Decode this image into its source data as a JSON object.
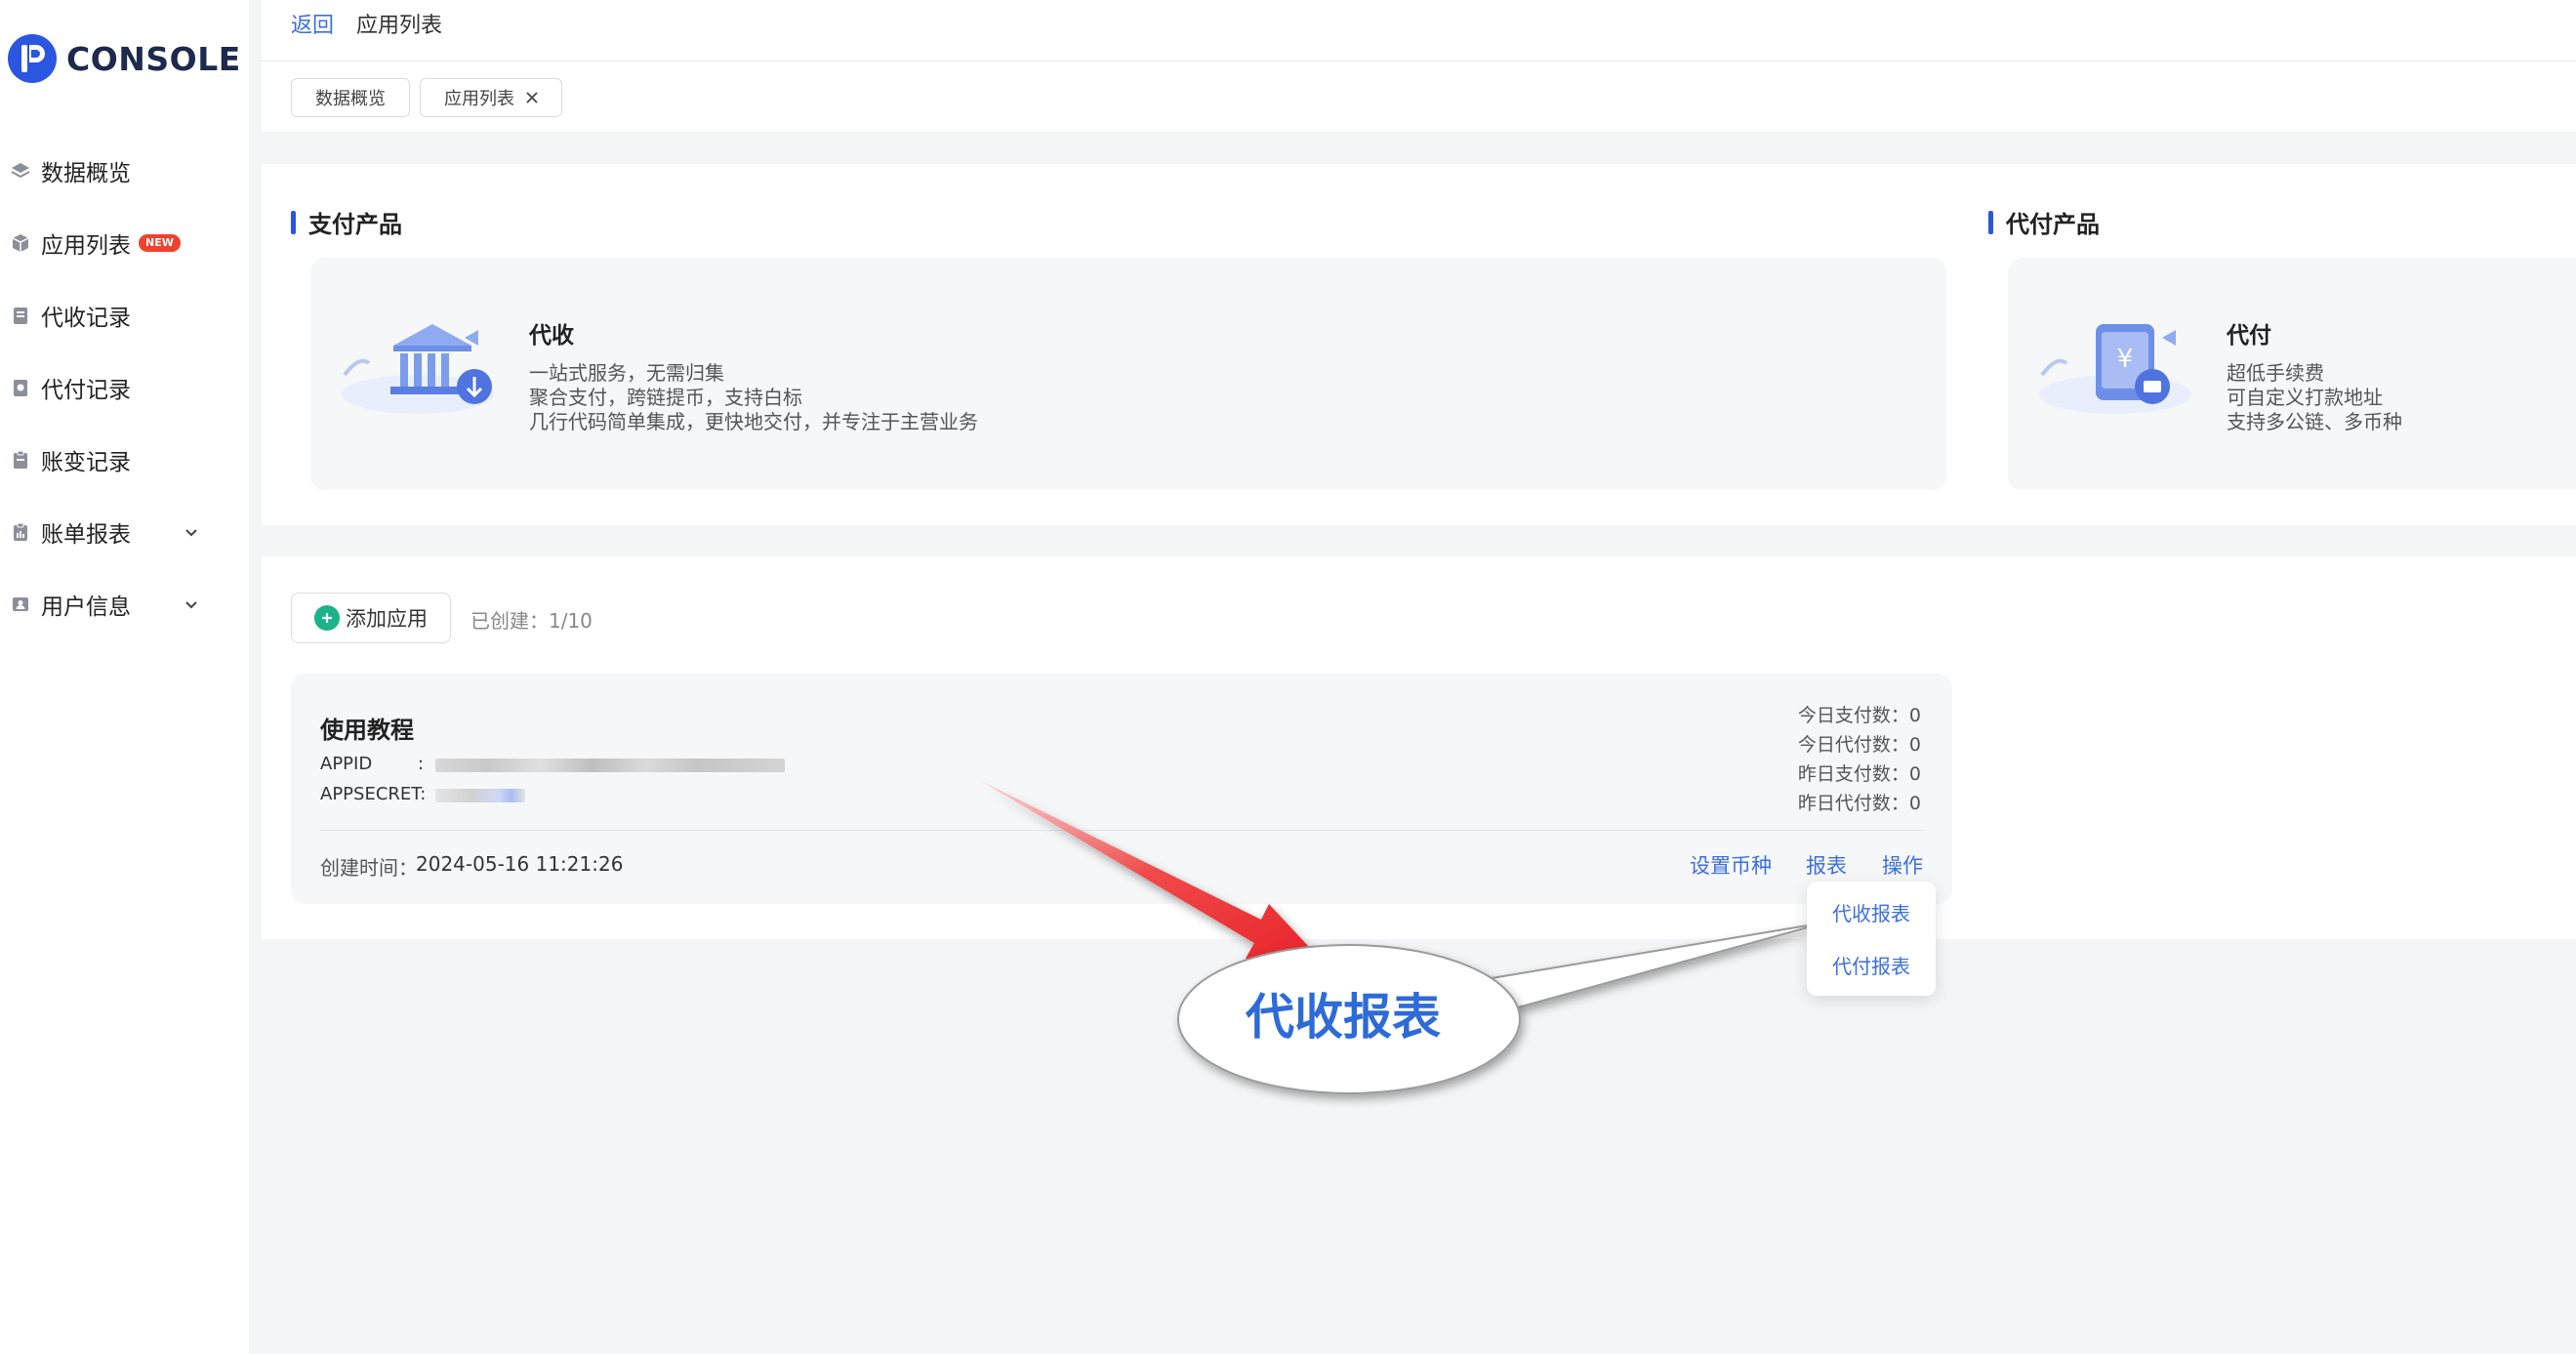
{
  "app": {
    "logo_text": "CONSOLE"
  },
  "sidebar": {
    "items": [
      {
        "label": "数据概览",
        "icon": "layers-icon"
      },
      {
        "label": "应用列表",
        "icon": "cube-icon",
        "badge": "NEW"
      },
      {
        "label": "代收记录",
        "icon": "receipt-icon"
      },
      {
        "label": "代付记录",
        "icon": "payout-record-icon"
      },
      {
        "label": "账变记录",
        "icon": "clipboard-icon"
      },
      {
        "label": "账单报表",
        "icon": "report-icon",
        "expandable": true
      },
      {
        "label": "用户信息",
        "icon": "user-card-icon",
        "expandable": true
      }
    ]
  },
  "header": {
    "back_label": "返回",
    "breadcrumb": "应用列表"
  },
  "tabs": [
    {
      "label": "数据概览",
      "closable": false
    },
    {
      "label": "应用列表",
      "closable": true
    }
  ],
  "products": {
    "pay_section_title": "支付产品",
    "payout_section_title": "代付产品",
    "collect": {
      "name": "代收",
      "lines": [
        "一站式服务，无需归集",
        "聚合支付，跨链提币，支持白标",
        "几行代码简单集成，更快地交付，并专注于主营业务"
      ]
    },
    "payout": {
      "name": "代付",
      "lines": [
        "超低手续费",
        "可自定义打款地址",
        "支持多公链、多币种"
      ]
    }
  },
  "apps": {
    "add_button": "添加应用",
    "created_text": "已创建：1/10",
    "card": {
      "name": "使用教程",
      "appid_label": "APPID",
      "appid_colon": ":",
      "appsecret_label": "APPSECRET:",
      "stats": [
        {
          "label": "今日支付数：",
          "value": "0"
        },
        {
          "label": "今日代付数：",
          "value": "0"
        },
        {
          "label": "昨日支付数：",
          "value": "0"
        },
        {
          "label": "昨日代付数：",
          "value": "0"
        }
      ],
      "created_label": "创建时间：",
      "created_value": "2024-05-16 11:21:26",
      "actions": {
        "set_currency": "设置币种",
        "report": "报表",
        "operate": "操作"
      }
    }
  },
  "dropdown": {
    "items": [
      "代收报表",
      "代付报表"
    ]
  },
  "callout": {
    "text": "代收报表"
  },
  "colors": {
    "accent": "#2b56e0",
    "link": "#3b6fe0",
    "badge": "#f0412f",
    "add_icon": "#1db38a",
    "arrow": "#e8232a"
  }
}
